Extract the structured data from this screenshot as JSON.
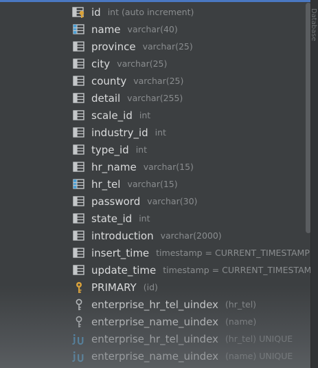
{
  "columns": [
    {
      "name": "id",
      "type": "int (auto increment)",
      "icon": "primary-key-column-icon"
    },
    {
      "name": "name",
      "type": "varchar(40)",
      "icon": "indexed-column-icon"
    },
    {
      "name": "province",
      "type": "varchar(25)",
      "icon": "column-icon"
    },
    {
      "name": "city",
      "type": "varchar(25)",
      "icon": "column-icon"
    },
    {
      "name": "county",
      "type": "varchar(25)",
      "icon": "column-icon"
    },
    {
      "name": "detail",
      "type": "varchar(255)",
      "icon": "column-icon"
    },
    {
      "name": "scale_id",
      "type": "int",
      "icon": "column-icon"
    },
    {
      "name": "industry_id",
      "type": "int",
      "icon": "column-icon"
    },
    {
      "name": "type_id",
      "type": "int",
      "icon": "column-icon"
    },
    {
      "name": "hr_name",
      "type": "varchar(15)",
      "icon": "column-icon"
    },
    {
      "name": "hr_tel",
      "type": "varchar(15)",
      "icon": "indexed-column-icon"
    },
    {
      "name": "password",
      "type": "varchar(30)",
      "icon": "column-icon"
    },
    {
      "name": "state_id",
      "type": "int",
      "icon": "column-icon"
    },
    {
      "name": "introduction",
      "type": "varchar(2000)",
      "icon": "column-icon"
    },
    {
      "name": "insert_time",
      "type": "timestamp = CURRENT_TIMESTAMP",
      "icon": "column-icon"
    },
    {
      "name": "update_time",
      "type": "timestamp = CURRENT_TIMESTAM",
      "icon": "column-icon"
    }
  ],
  "keys": [
    {
      "name": "PRIMARY",
      "detail": "(id)",
      "suffix": "",
      "icon": "primary-key-icon"
    },
    {
      "name": "enterprise_hr_tel_uindex",
      "detail": "(hr_tel)",
      "suffix": "",
      "icon": "index-key-icon"
    },
    {
      "name": "enterprise_name_uindex",
      "detail": "(name)",
      "suffix": "",
      "icon": "index-key-icon"
    },
    {
      "name": "enterprise_hr_tel_uindex",
      "detail": "(hr_tel)",
      "suffix": "UNIQUE",
      "icon": "unique-index-icon"
    },
    {
      "name": "enterprise_name_uindex",
      "detail": "(name)",
      "suffix": "UNIQUE",
      "icon": "unique-index-icon"
    }
  ],
  "side_label": "Database",
  "colors": {
    "background": "#3c3f41",
    "text": "#dadbdc",
    "type_text": "#8a8d8f",
    "table_icon": "#c4c7c9",
    "index_accent": "#4a9fd5",
    "key_gold": "#d9a23b"
  }
}
